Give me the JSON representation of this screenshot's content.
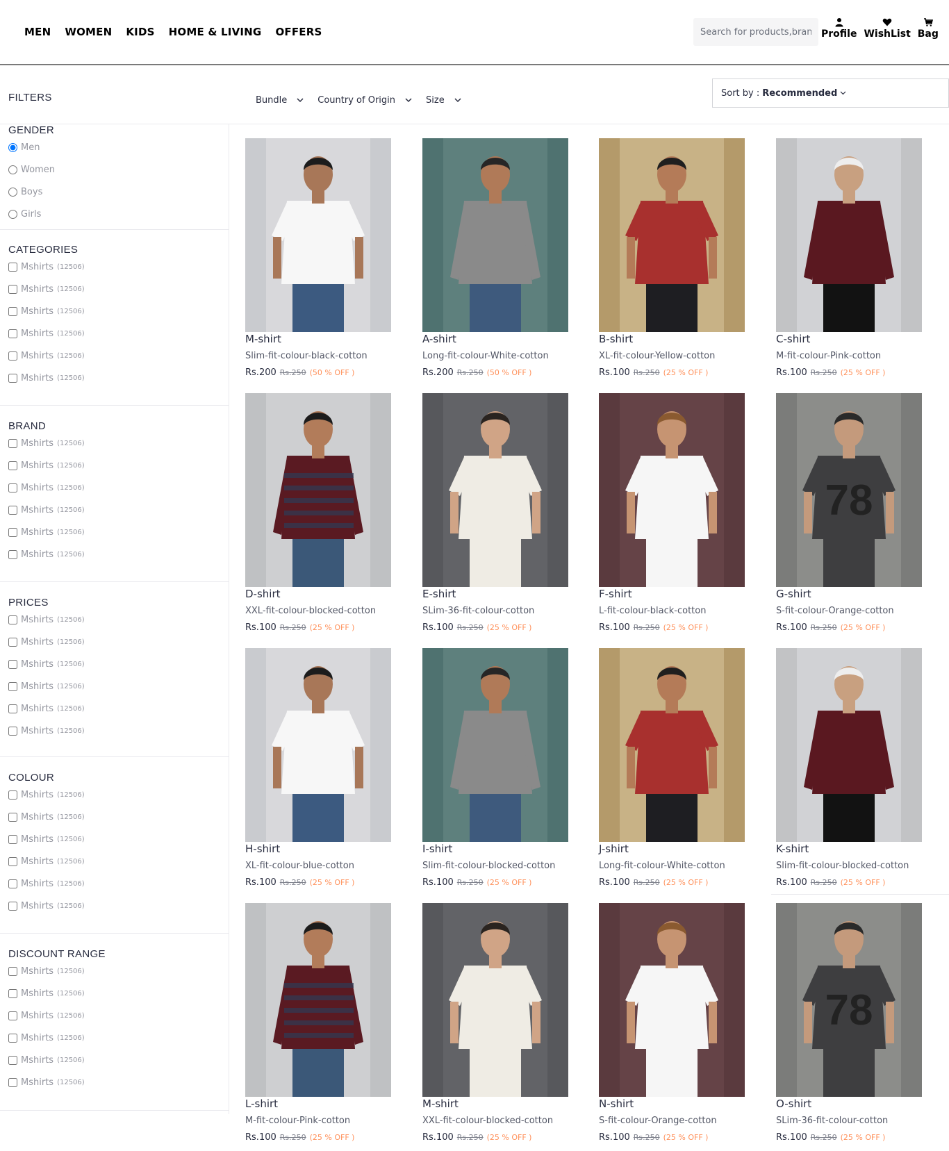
{
  "nav": [
    "MEN",
    "WOMEN",
    "KIDS",
    "HOME & LIVING",
    "OFFERS"
  ],
  "search": {
    "placeholder": "Search for products,brands and more"
  },
  "header_actions": [
    {
      "label": "Profile",
      "icon": "user-icon"
    },
    {
      "label": "WishList",
      "icon": "heart-icon"
    },
    {
      "label": "Bag",
      "icon": "bag-icon"
    }
  ],
  "filters_title": "FILTERS",
  "filter_bar": [
    "Bundle",
    "Country of Origin",
    "Size"
  ],
  "sort": {
    "prefix": "Sort by :",
    "value": "Recommended"
  },
  "gender": {
    "title": "GENDER",
    "options": [
      "Men",
      "Women",
      "Boys",
      "Girls"
    ],
    "selected": "Men"
  },
  "filter_sections": [
    {
      "title": "CATEGORIES",
      "options": [
        {
          "label": "Mshirts",
          "count": "(12506)"
        },
        {
          "label": "Mshirts",
          "count": "(12506)"
        },
        {
          "label": "Mshirts",
          "count": "(12506)"
        },
        {
          "label": "Mshirts",
          "count": "(12506)"
        },
        {
          "label": "Mshirts",
          "count": "(12506)"
        },
        {
          "label": "Mshirts",
          "count": "(12506)"
        }
      ]
    },
    {
      "title": "BRAND",
      "options": [
        {
          "label": "Mshirts",
          "count": "(12506)"
        },
        {
          "label": "Mshirts",
          "count": "(12506)"
        },
        {
          "label": "Mshirts",
          "count": "(12506)"
        },
        {
          "label": "Mshirts",
          "count": "(12506)"
        },
        {
          "label": "Mshirts",
          "count": "(12506)"
        },
        {
          "label": "Mshirts",
          "count": "(12506)"
        }
      ]
    },
    {
      "title": "PRICES",
      "options": [
        {
          "label": "Mshirts",
          "count": "(12506)"
        },
        {
          "label": "Mshirts",
          "count": "(12506)"
        },
        {
          "label": "Mshirts",
          "count": "(12506)"
        },
        {
          "label": "Mshirts",
          "count": "(12506)"
        },
        {
          "label": "Mshirts",
          "count": "(12506)"
        },
        {
          "label": "Mshirts",
          "count": "(12506)"
        }
      ]
    },
    {
      "title": "COLOUR",
      "options": [
        {
          "label": "Mshirts",
          "count": "(12506)"
        },
        {
          "label": "Mshirts",
          "count": "(12506)"
        },
        {
          "label": "Mshirts",
          "count": "(12506)"
        },
        {
          "label": "Mshirts",
          "count": "(12506)"
        },
        {
          "label": "Mshirts",
          "count": "(12506)"
        },
        {
          "label": "Mshirts",
          "count": "(12506)"
        }
      ]
    },
    {
      "title": "DISCOUNT RANGE",
      "options": [
        {
          "label": "Mshirts",
          "count": "(12506)"
        },
        {
          "label": "Mshirts",
          "count": "(12506)"
        },
        {
          "label": "Mshirts",
          "count": "(12506)"
        },
        {
          "label": "Mshirts",
          "count": "(12506)"
        },
        {
          "label": "Mshirts",
          "count": "(12506)"
        },
        {
          "label": "Mshirts",
          "count": "(12506)"
        }
      ]
    }
  ],
  "products": [
    {
      "name": "M-shirt",
      "desc": "Slim-fit-colour-black-cotton",
      "price": "Rs.200",
      "mrp": "Rs.250",
      "off": "(50 % OFF )",
      "photo": "white-tee-model"
    },
    {
      "name": "A-shirt",
      "desc": "Long-fit-colour-White-cotton",
      "price": "Rs.200",
      "mrp": "Rs.250",
      "off": "(50 % OFF )",
      "photo": "grey-longsleeve-model"
    },
    {
      "name": "B-shirt",
      "desc": "XL-fit-colour-Yellow-cotton",
      "price": "Rs.100",
      "mrp": "Rs.250",
      "off": "(25 % OFF )",
      "photo": "red-graphic-tee-model"
    },
    {
      "name": "C-shirt",
      "desc": "M-fit-colour-Pink-cotton",
      "price": "Rs.100",
      "mrp": "Rs.250",
      "off": "(25 % OFF )",
      "photo": "maroon-sweatshirt-model"
    },
    {
      "name": "D-shirt",
      "desc": "XXL-fit-colour-blocked-cotton",
      "price": "Rs.100",
      "mrp": "Rs.250",
      "off": "(25 % OFF )",
      "photo": "striped-tee-model"
    },
    {
      "name": "E-shirt",
      "desc": "SLim-36-fit-colour-cotton",
      "price": "Rs.100",
      "mrp": "Rs.250",
      "off": "(25 % OFF )",
      "photo": "white-polo-model"
    },
    {
      "name": "F-shirt",
      "desc": "L-fit-colour-black-cotton",
      "price": "Rs.100",
      "mrp": "Rs.250",
      "off": "(25 % OFF )",
      "photo": "white-tee-curly-model"
    },
    {
      "name": "G-shirt",
      "desc": "S-fit-colour-Orange-cotton",
      "price": "Rs.100",
      "mrp": "Rs.250",
      "off": "(25 % OFF )",
      "photo": "grey-78-tee-model"
    },
    {
      "name": "H-shirt",
      "desc": "XL-fit-colour-blue-cotton",
      "price": "Rs.100",
      "mrp": "Rs.250",
      "off": "(25 % OFF )",
      "photo": "white-tee-model"
    },
    {
      "name": "I-shirt",
      "desc": "Slim-fit-colour-blocked-cotton",
      "price": "Rs.100",
      "mrp": "Rs.250",
      "off": "(25 % OFF )",
      "photo": "grey-longsleeve-model"
    },
    {
      "name": "J-shirt",
      "desc": "Long-fit-colour-White-cotton",
      "price": "Rs.100",
      "mrp": "Rs.250",
      "off": "(25 % OFF )",
      "photo": "red-graphic-tee-model"
    },
    {
      "name": "K-shirt",
      "desc": "Slim-fit-colour-blocked-cotton",
      "price": "Rs.100",
      "mrp": "Rs.250",
      "off": "(25 % OFF )",
      "photo": "maroon-sweatshirt-model"
    },
    {
      "name": "L-shirt",
      "desc": "M-fit-colour-Pink-cotton",
      "price": "Rs.100",
      "mrp": "Rs.250",
      "off": "(25 % OFF )",
      "photo": "striped-tee-model"
    },
    {
      "name": "M-shirt",
      "desc": "XXL-fit-colour-blocked-cotton",
      "price": "Rs.100",
      "mrp": "Rs.250",
      "off": "(25 % OFF )",
      "photo": "white-polo-model"
    },
    {
      "name": "N-shirt",
      "desc": "S-fit-colour-Orange-cotton",
      "price": "Rs.100",
      "mrp": "Rs.250",
      "off": "(25 % OFF )",
      "photo": "white-tee-curly-model"
    },
    {
      "name": "O-shirt",
      "desc": "SLim-36-fit-colour-cotton",
      "price": "Rs.100",
      "mrp": "Rs.250",
      "off": "(25 % OFF )",
      "photo": "grey-78-tee-model"
    }
  ],
  "colors": {
    "accent": "#ff905a",
    "text": "#282c3f",
    "muted": "#94969f",
    "radio": "#1a73e8"
  }
}
